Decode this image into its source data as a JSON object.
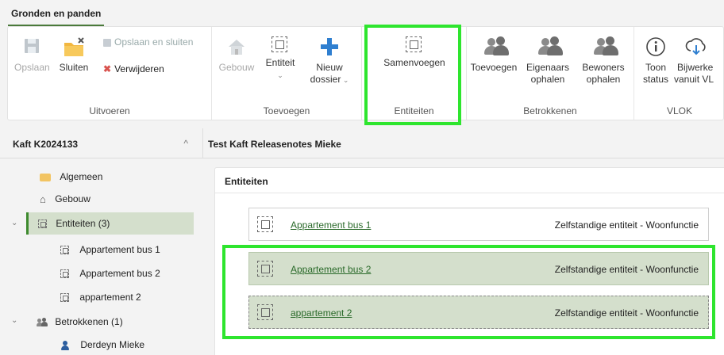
{
  "tabs": {
    "active": "Gronden en panden"
  },
  "ribbon": {
    "uitvoeren": {
      "label": "Uitvoeren",
      "opslaan": "Opslaan",
      "sluiten": "Sluiten",
      "opslaan_en_sluiten": "Opslaan en sluiten",
      "verwijderen": "Verwijderen"
    },
    "toevoegen": {
      "label": "Toevoegen",
      "gebouw": "Gebouw",
      "entiteit": "Entiteit",
      "nieuw_line1": "Nieuw",
      "nieuw_line2": "dossier"
    },
    "entiteiten": {
      "label": "Entiteiten",
      "samenvoegen": "Samenvoegen"
    },
    "betrokkenen": {
      "label": "Betrokkenen",
      "toevoegen": "Toevoegen",
      "eigenaars_line1": "Eigenaars",
      "eigenaars_line2": "ophalen",
      "bewoners_line1": "Bewoners",
      "bewoners_line2": "ophalen"
    },
    "vlok": {
      "label": "VLOK",
      "toon_line1": "Toon",
      "toon_line2": "status",
      "bijwerken_line1": "Bijwerke",
      "bijwerken_line2": "vanuit VL"
    }
  },
  "left_panel": {
    "title": "Kaft K2024133",
    "tree": {
      "algemeen": "Algemeen",
      "gebouw": "Gebouw",
      "entiteiten": "Entiteiten (3)",
      "app1": "Appartement bus 1",
      "app2": "Appartement bus 2",
      "app3": "appartement 2",
      "betrokkenen": "Betrokkenen (1)",
      "derdeyn": "Derdeyn Mieke"
    }
  },
  "main_panel": {
    "title": "Test Kaft Releasenotes Mieke",
    "card_title": "Entiteiten",
    "rows": [
      {
        "name": "Appartement bus 1",
        "type": "Zelfstandige entiteit - Woonfunctie"
      },
      {
        "name": "Appartement bus 2",
        "type": "Zelfstandige entiteit - Woonfunctie"
      },
      {
        "name": "appartement 2",
        "type": "Zelfstandige entiteit - Woonfunctie"
      }
    ]
  },
  "colors": {
    "highlight": "#2ee52e",
    "accent_green": "#3d8a2e",
    "selected_bg": "#d4dfcc",
    "link": "#2a6a2a"
  }
}
